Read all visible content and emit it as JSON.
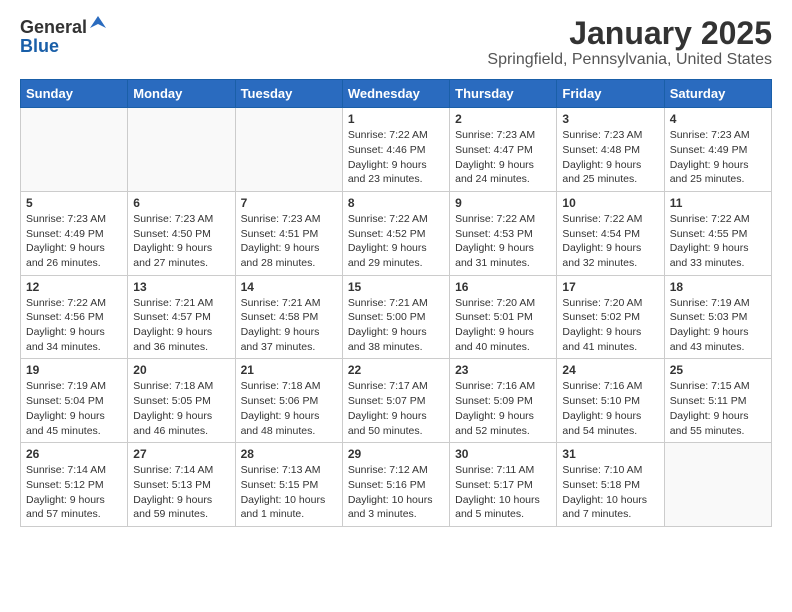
{
  "logo": {
    "general": "General",
    "blue": "Blue"
  },
  "title": "January 2025",
  "subtitle": "Springfield, Pennsylvania, United States",
  "days_of_week": [
    "Sunday",
    "Monday",
    "Tuesday",
    "Wednesday",
    "Thursday",
    "Friday",
    "Saturday"
  ],
  "weeks": [
    [
      {
        "day": "",
        "info": ""
      },
      {
        "day": "",
        "info": ""
      },
      {
        "day": "",
        "info": ""
      },
      {
        "day": "1",
        "info": "Sunrise: 7:22 AM\nSunset: 4:46 PM\nDaylight: 9 hours\nand 23 minutes."
      },
      {
        "day": "2",
        "info": "Sunrise: 7:23 AM\nSunset: 4:47 PM\nDaylight: 9 hours\nand 24 minutes."
      },
      {
        "day": "3",
        "info": "Sunrise: 7:23 AM\nSunset: 4:48 PM\nDaylight: 9 hours\nand 25 minutes."
      },
      {
        "day": "4",
        "info": "Sunrise: 7:23 AM\nSunset: 4:49 PM\nDaylight: 9 hours\nand 25 minutes."
      }
    ],
    [
      {
        "day": "5",
        "info": "Sunrise: 7:23 AM\nSunset: 4:49 PM\nDaylight: 9 hours\nand 26 minutes."
      },
      {
        "day": "6",
        "info": "Sunrise: 7:23 AM\nSunset: 4:50 PM\nDaylight: 9 hours\nand 27 minutes."
      },
      {
        "day": "7",
        "info": "Sunrise: 7:23 AM\nSunset: 4:51 PM\nDaylight: 9 hours\nand 28 minutes."
      },
      {
        "day": "8",
        "info": "Sunrise: 7:22 AM\nSunset: 4:52 PM\nDaylight: 9 hours\nand 29 minutes."
      },
      {
        "day": "9",
        "info": "Sunrise: 7:22 AM\nSunset: 4:53 PM\nDaylight: 9 hours\nand 31 minutes."
      },
      {
        "day": "10",
        "info": "Sunrise: 7:22 AM\nSunset: 4:54 PM\nDaylight: 9 hours\nand 32 minutes."
      },
      {
        "day": "11",
        "info": "Sunrise: 7:22 AM\nSunset: 4:55 PM\nDaylight: 9 hours\nand 33 minutes."
      }
    ],
    [
      {
        "day": "12",
        "info": "Sunrise: 7:22 AM\nSunset: 4:56 PM\nDaylight: 9 hours\nand 34 minutes."
      },
      {
        "day": "13",
        "info": "Sunrise: 7:21 AM\nSunset: 4:57 PM\nDaylight: 9 hours\nand 36 minutes."
      },
      {
        "day": "14",
        "info": "Sunrise: 7:21 AM\nSunset: 4:58 PM\nDaylight: 9 hours\nand 37 minutes."
      },
      {
        "day": "15",
        "info": "Sunrise: 7:21 AM\nSunset: 5:00 PM\nDaylight: 9 hours\nand 38 minutes."
      },
      {
        "day": "16",
        "info": "Sunrise: 7:20 AM\nSunset: 5:01 PM\nDaylight: 9 hours\nand 40 minutes."
      },
      {
        "day": "17",
        "info": "Sunrise: 7:20 AM\nSunset: 5:02 PM\nDaylight: 9 hours\nand 41 minutes."
      },
      {
        "day": "18",
        "info": "Sunrise: 7:19 AM\nSunset: 5:03 PM\nDaylight: 9 hours\nand 43 minutes."
      }
    ],
    [
      {
        "day": "19",
        "info": "Sunrise: 7:19 AM\nSunset: 5:04 PM\nDaylight: 9 hours\nand 45 minutes."
      },
      {
        "day": "20",
        "info": "Sunrise: 7:18 AM\nSunset: 5:05 PM\nDaylight: 9 hours\nand 46 minutes."
      },
      {
        "day": "21",
        "info": "Sunrise: 7:18 AM\nSunset: 5:06 PM\nDaylight: 9 hours\nand 48 minutes."
      },
      {
        "day": "22",
        "info": "Sunrise: 7:17 AM\nSunset: 5:07 PM\nDaylight: 9 hours\nand 50 minutes."
      },
      {
        "day": "23",
        "info": "Sunrise: 7:16 AM\nSunset: 5:09 PM\nDaylight: 9 hours\nand 52 minutes."
      },
      {
        "day": "24",
        "info": "Sunrise: 7:16 AM\nSunset: 5:10 PM\nDaylight: 9 hours\nand 54 minutes."
      },
      {
        "day": "25",
        "info": "Sunrise: 7:15 AM\nSunset: 5:11 PM\nDaylight: 9 hours\nand 55 minutes."
      }
    ],
    [
      {
        "day": "26",
        "info": "Sunrise: 7:14 AM\nSunset: 5:12 PM\nDaylight: 9 hours\nand 57 minutes."
      },
      {
        "day": "27",
        "info": "Sunrise: 7:14 AM\nSunset: 5:13 PM\nDaylight: 9 hours\nand 59 minutes."
      },
      {
        "day": "28",
        "info": "Sunrise: 7:13 AM\nSunset: 5:15 PM\nDaylight: 10 hours\nand 1 minute."
      },
      {
        "day": "29",
        "info": "Sunrise: 7:12 AM\nSunset: 5:16 PM\nDaylight: 10 hours\nand 3 minutes."
      },
      {
        "day": "30",
        "info": "Sunrise: 7:11 AM\nSunset: 5:17 PM\nDaylight: 10 hours\nand 5 minutes."
      },
      {
        "day": "31",
        "info": "Sunrise: 7:10 AM\nSunset: 5:18 PM\nDaylight: 10 hours\nand 7 minutes."
      },
      {
        "day": "",
        "info": ""
      }
    ]
  ]
}
